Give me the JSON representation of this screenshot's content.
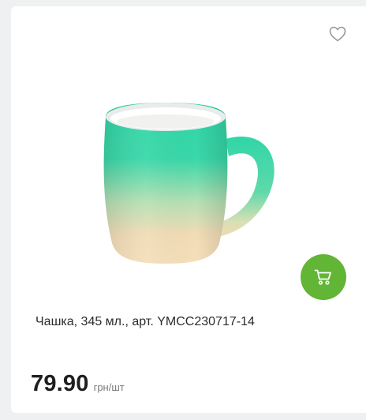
{
  "product": {
    "title": "Чашка, 345 мл., арт. YMCC230717-14",
    "price": "79.90",
    "price_unit": "грн/шт",
    "image_icon": "mug-product-image",
    "favorite_icon": "heart-outline-icon",
    "cart_icon": "shopping-cart-icon"
  },
  "colors": {
    "cart_button": "#62b535",
    "mug_top": "#2fd7a8",
    "mug_bottom": "#f3dcb6",
    "favorite_icon": "#9a9a9a"
  }
}
